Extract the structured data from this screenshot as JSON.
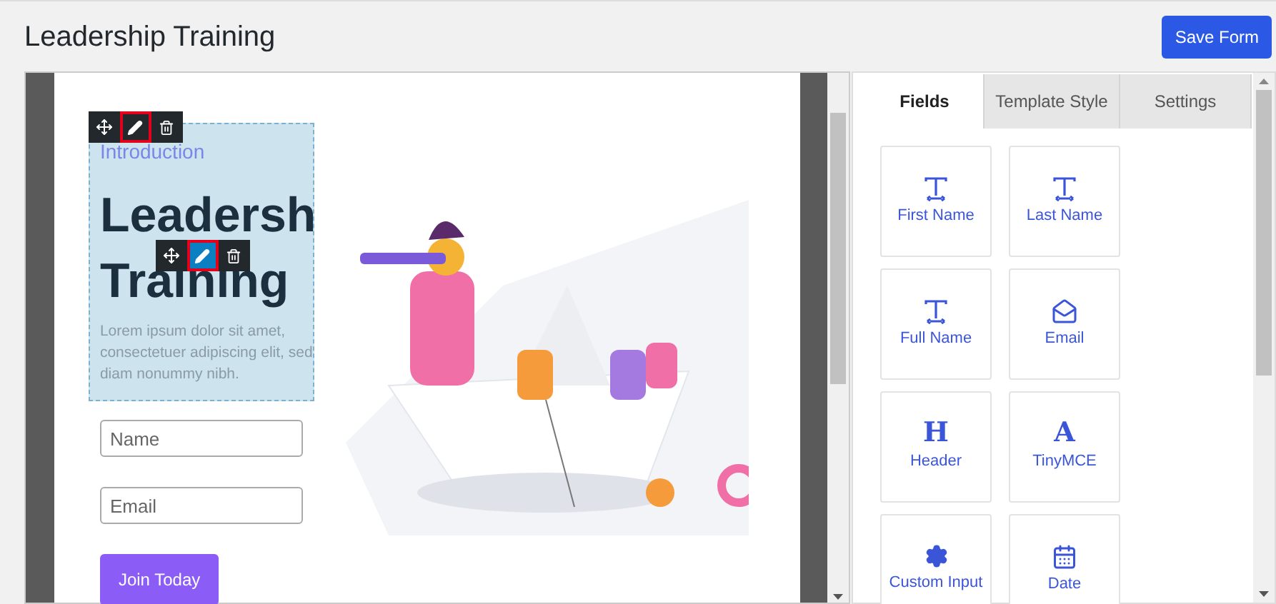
{
  "header": {
    "title": "Leadership Training",
    "save_button": "Save Form"
  },
  "canvas": {
    "block": {
      "subtitle": "Introduction",
      "heading_lines": [
        "Leadersh",
        "Training"
      ],
      "body": "Lorem ipsum dolor sit amet, consectetuer adipiscing elit, sed diam nonummy nibh."
    },
    "toolbars": [
      {
        "tools": [
          {
            "kind": "move",
            "outlined": false,
            "active": false
          },
          {
            "kind": "edit",
            "outlined": true,
            "active": false
          },
          {
            "kind": "delete",
            "outlined": false,
            "active": false
          }
        ]
      },
      {
        "tools": [
          {
            "kind": "move",
            "outlined": false,
            "active": false
          },
          {
            "kind": "edit",
            "outlined": true,
            "active": true
          },
          {
            "kind": "delete",
            "outlined": false,
            "active": false
          }
        ]
      }
    ],
    "inputs": [
      {
        "placeholder": "Name"
      },
      {
        "placeholder": "Email"
      }
    ],
    "button": "Join Today"
  },
  "panel": {
    "tabs": [
      {
        "label": "Fields",
        "selected": true
      },
      {
        "label": "Template Style",
        "selected": false
      },
      {
        "label": "Settings",
        "selected": false
      }
    ],
    "fields": [
      {
        "label": "First Name",
        "kind": "text"
      },
      {
        "label": "Last Name",
        "kind": "text"
      },
      {
        "label": "Full Name",
        "kind": "text"
      },
      {
        "label": "Email",
        "kind": "email"
      },
      {
        "label": "Header",
        "kind": "header",
        "icon_text": "H"
      },
      {
        "label": "TinyMCE",
        "kind": "rich",
        "icon_text": "A"
      },
      {
        "label": "Custom Input",
        "kind": "custom"
      },
      {
        "label": "Date",
        "kind": "date"
      }
    ]
  }
}
